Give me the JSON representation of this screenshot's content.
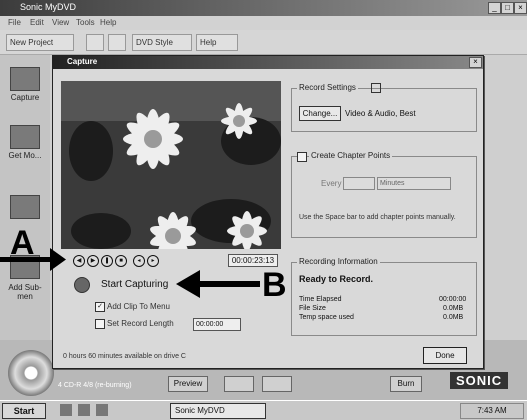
{
  "app": {
    "title": "Sonic MyDVD",
    "menu": [
      "File",
      "Edit",
      "View",
      "Tools",
      "Help"
    ],
    "toolbar": {
      "new_project": "New Project",
      "preview_mode": "DVD Style",
      "help": "Help"
    },
    "left_pane": [
      "Capture",
      "Get Mo...",
      "",
      "Add Sub-men"
    ],
    "bottom": {
      "caption": "4 CD-R 4/8 (re-burning)",
      "preview": "Preview",
      "burn": "Burn",
      "brand": "SONIC"
    }
  },
  "dialog": {
    "title": "Capture",
    "timecode": "00:00:23:13",
    "start_label": "Start Capturing",
    "add_clip_label": "Add Clip To Menu",
    "set_length_label": "Set Record Length",
    "length_value": "00:00:00",
    "status_text": "0 hours 60 minutes available on drive C",
    "done_label": "Done",
    "record_settings": {
      "title": "Record Settings",
      "change_label": "Change...",
      "value": "Video & Audio, Best"
    },
    "chapter": {
      "label": "Create Chapter Points",
      "every_label": "Every",
      "every_value": "",
      "unit_value": "Minutes",
      "hint": "Use the Space bar to add chapter points manually."
    },
    "recording_info": {
      "title": "Recording Information",
      "state": "Ready to Record.",
      "rows": [
        {
          "label": "Time Elapsed",
          "value": "00:00:00"
        },
        {
          "label": "File Size",
          "value": "0.0MB"
        },
        {
          "label": "Temp space used",
          "value": "0.0MB"
        }
      ]
    }
  },
  "taskbar": {
    "start": "Start",
    "task": "Sonic MyDVD",
    "clock": "7:43 AM"
  },
  "annotations": {
    "a": "A",
    "b": "B"
  }
}
